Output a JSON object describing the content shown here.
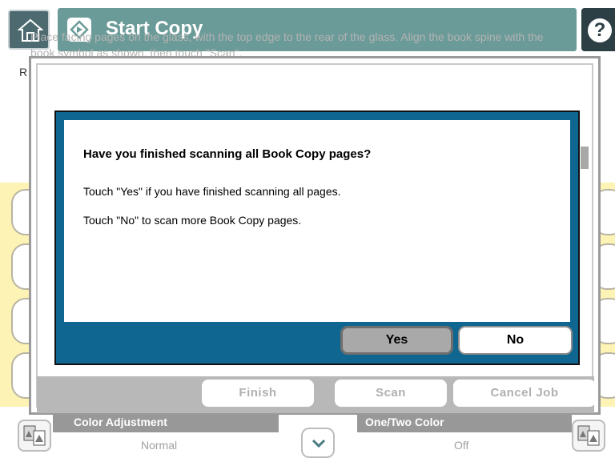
{
  "header": {
    "title": "Start Copy",
    "help_symbol": "?",
    "icons": {
      "home": "home-icon",
      "start": "start-copy-icon",
      "help": "help-icon"
    }
  },
  "background": {
    "label_fragment": "R"
  },
  "dialog": {
    "instructions": "Place facing pages on the glass, with the top edge to the rear of the glass. Align the book spine with the book symbol as shown, then touch \"Scan\".",
    "buttons": {
      "finish": "Finish",
      "scan": "Scan",
      "cancel_job": "Cancel Job"
    }
  },
  "modal": {
    "question": "Have you finished scanning all Book Copy pages?",
    "line1": "Touch \"Yes\" if you have finished scanning all pages.",
    "line2": "Touch \"No\" to scan more Book Copy pages.",
    "yes_label": "Yes",
    "no_label": "No"
  },
  "status": {
    "color_adjustment": {
      "label": "Color Adjustment",
      "value": "Normal"
    },
    "one_two_color": {
      "label": "One/Two Color",
      "value": "Off"
    }
  },
  "colors": {
    "title_bar": "#6b9b98",
    "modal_accent": "#0f6691",
    "background_band": "#fdf3b4"
  }
}
